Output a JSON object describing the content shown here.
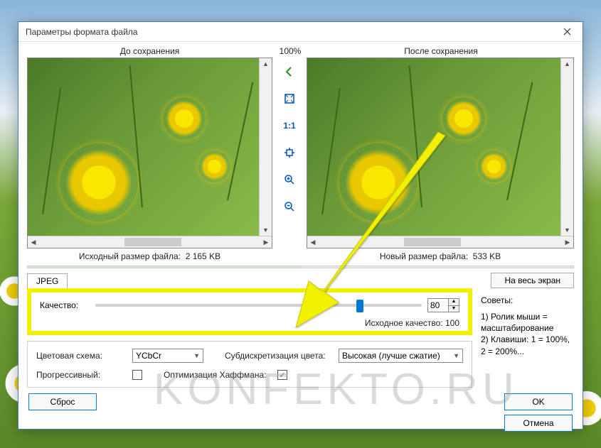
{
  "dialog": {
    "title": "Параметры формата файла",
    "zoom": "100%",
    "before_label": "До сохранения",
    "after_label": "После сохранения",
    "original_size_label": "Исходный размер файла:",
    "original_size_value": "2 165 KB",
    "new_size_label": "Новый размер файла:",
    "new_size_value": "533 KB",
    "tab_label": "JPEG",
    "fullscreen_label": "На весь экран"
  },
  "quality": {
    "label": "Качество:",
    "value": "80",
    "slider_percent": 80,
    "original_label": "Исходное качество:",
    "original_value": "100"
  },
  "options": {
    "color_scheme_label": "Цветовая схема:",
    "color_scheme_value": "YCbCr",
    "subsampling_label": "Субдискретизация цвета:",
    "subsampling_value": "Высокая (лучше сжатие)",
    "progressive_label": "Прогрессивный:",
    "progressive_checked": false,
    "huffman_label": "Оптимизация Хаффмана:",
    "huffman_checked": true
  },
  "tips": {
    "title": "Советы:",
    "line1": "1) Ролик мыши = масштабирование",
    "line2": "2) Клавиши: 1 = 100%, 2 = 200%..."
  },
  "buttons": {
    "reset": "Сброс",
    "ok": "OK",
    "cancel": "Отмена"
  },
  "watermark": "KONFEKTO.RU"
}
